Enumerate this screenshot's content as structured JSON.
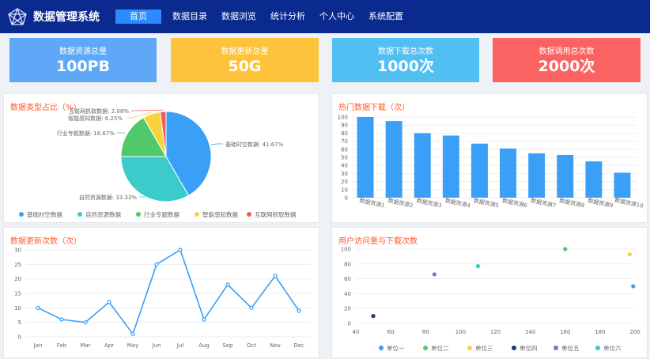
{
  "app": {
    "title": "数据管理系统"
  },
  "nav": [
    {
      "label": "首页",
      "active": true
    },
    {
      "label": "数据目录",
      "active": false
    },
    {
      "label": "数据浏览",
      "active": false
    },
    {
      "label": "统计分析",
      "active": false
    },
    {
      "label": "个人中心",
      "active": false
    },
    {
      "label": "系统配置",
      "active": false
    }
  ],
  "stats": [
    {
      "label": "数据资源总量",
      "value": "100PB",
      "color": "#5ea8f7"
    },
    {
      "label": "数据更新总量",
      "value": "50G",
      "color": "#fdc33a"
    },
    {
      "label": "数据下载总次数",
      "value": "1000次",
      "color": "#52bff2"
    },
    {
      "label": "数据调用总次数",
      "value": "2000次",
      "color": "#fb6262"
    }
  ],
  "charts": {
    "pie": {
      "title": "数据类型占比（%）"
    },
    "bar": {
      "title": "热门数据下载（次）"
    },
    "line": {
      "title": "数据更新次数（次）"
    },
    "scatter": {
      "title": "用户访问量与下载次数"
    }
  },
  "chart_data": [
    {
      "type": "pie",
      "title": "数据类型占比（%）",
      "slices": [
        {
          "name": "基础时空数据",
          "value": 41.67,
          "label": "基础时空数据: 41.67%",
          "color": "#3a9ff6"
        },
        {
          "name": "自然资源数据",
          "value": 33.33,
          "label": "自然资源数据: 33.33%",
          "color": "#3bcbcb"
        },
        {
          "name": "行业专题数据",
          "value": 16.67,
          "label": "行业专题数据: 16.67%",
          "color": "#4fc96a"
        },
        {
          "name": "智能感知数据",
          "value": 6.25,
          "label": "智能感知数据: 6.25%",
          "color": "#fbd23c"
        },
        {
          "name": "互联网抓取数据",
          "value": 2.08,
          "label": "互联网抓取数据: 2.08%",
          "color": "#f25c5c"
        }
      ],
      "legend_position": "bottom"
    },
    {
      "type": "bar",
      "title": "热门数据下载（次）",
      "categories": [
        "数据资源1",
        "数据资源2",
        "数据资源3",
        "数据资源4",
        "数据资源5",
        "数据资源6",
        "数据资源7",
        "数据资源8",
        "数据资源9",
        "数据资源10"
      ],
      "values": [
        100,
        95,
        80,
        77,
        67,
        61,
        55,
        53,
        45,
        31
      ],
      "ylim": [
        0,
        100
      ],
      "yticks": [
        0,
        10,
        20,
        30,
        40,
        50,
        60,
        70,
        80,
        90,
        100
      ],
      "color": "#3a9ff6",
      "grid": true
    },
    {
      "type": "line",
      "title": "数据更新次数（次）",
      "categories": [
        "Jan",
        "Feb",
        "Mar",
        "Apr",
        "May",
        "Jun",
        "Jul",
        "Aug",
        "Sep",
        "Oct",
        "Nov",
        "Dec"
      ],
      "values": [
        10,
        6,
        5,
        12,
        1,
        25,
        30,
        6,
        18,
        10,
        21,
        9
      ],
      "ylim": [
        0,
        30
      ],
      "yticks": [
        0,
        5,
        10,
        15,
        20,
        25,
        30
      ],
      "color": "#3a9ff6",
      "grid": true
    },
    {
      "type": "scatter",
      "title": "用户访问量与下载次数",
      "xlim": [
        40,
        200
      ],
      "ylim": [
        0,
        100
      ],
      "xticks": [
        40,
        60,
        80,
        100,
        120,
        140,
        160,
        180,
        200
      ],
      "yticks": [
        0,
        20,
        40,
        60,
        80,
        100
      ],
      "series": [
        {
          "name": "单位一",
          "color": "#3a9ff6",
          "points": [
            [
              199,
              50
            ]
          ]
        },
        {
          "name": "单位二",
          "color": "#4fc96a",
          "points": [
            [
              160,
              100
            ]
          ]
        },
        {
          "name": "单位三",
          "color": "#fbd23c",
          "points": [
            [
              197,
              93
            ]
          ]
        },
        {
          "name": "单位四",
          "color": "#1f3a7a",
          "points": [
            [
              50,
              10
            ]
          ]
        },
        {
          "name": "单位五",
          "color": "#9566cf",
          "points": [
            [
              85,
              66
            ]
          ]
        },
        {
          "name": "单位六",
          "color": "#3bcbcb",
          "points": [
            [
              110,
              77
            ]
          ]
        }
      ],
      "legend_position": "bottom",
      "grid": true
    }
  ]
}
